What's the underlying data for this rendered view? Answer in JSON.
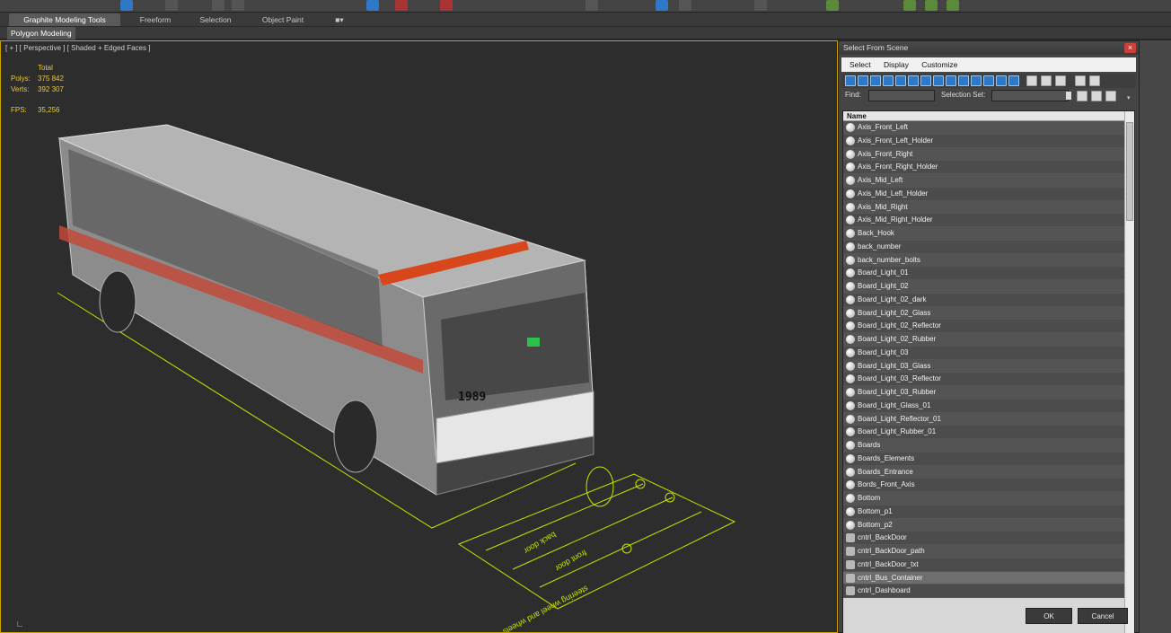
{
  "ribbon": {
    "tabs": [
      "Graphite Modeling Tools",
      "Freeform",
      "Selection",
      "Object Paint"
    ],
    "subtab": "Polygon Modeling"
  },
  "viewport": {
    "label": "[ + ] [ Perspective ] [ Shaded + Edged Faces ]",
    "stats_header": "Total",
    "polys_label": "Polys:",
    "polys_value": "375 842",
    "verts_label": "Verts:",
    "verts_value": "392 307",
    "fps_label": "FPS:",
    "fps_value": "35,256",
    "bus_number": "1989",
    "rig_labels": [
      "back door",
      "front door",
      "steering wheel and wheels"
    ]
  },
  "dialog": {
    "title": "Select From Scene",
    "close": "×",
    "menu": [
      "Select",
      "Display",
      "Customize"
    ],
    "find_label": "Find:",
    "find_value": "",
    "selset_label": "Selection Set:",
    "list_header": "Name",
    "items": [
      {
        "name": "Axis_Front_Left",
        "icon": "sphere"
      },
      {
        "name": "Axis_Front_Left_Holder",
        "icon": "sphere"
      },
      {
        "name": "Axis_Front_Right",
        "icon": "sphere"
      },
      {
        "name": "Axis_Front_Right_Holder",
        "icon": "sphere"
      },
      {
        "name": "Axis_Mid_Left",
        "icon": "sphere"
      },
      {
        "name": "Axis_Mid_Left_Holder",
        "icon": "sphere"
      },
      {
        "name": "Axis_Mid_Right",
        "icon": "sphere"
      },
      {
        "name": "Axis_Mid_Right_Holder",
        "icon": "sphere"
      },
      {
        "name": "Back_Hook",
        "icon": "sphere"
      },
      {
        "name": "back_number",
        "icon": "sphere"
      },
      {
        "name": "back_number_bolts",
        "icon": "sphere"
      },
      {
        "name": "Board_Light_01",
        "icon": "sphere"
      },
      {
        "name": "Board_Light_02",
        "icon": "sphere"
      },
      {
        "name": "Board_Light_02_dark",
        "icon": "sphere"
      },
      {
        "name": "Board_Light_02_Glass",
        "icon": "sphere"
      },
      {
        "name": "Board_Light_02_Reflector",
        "icon": "sphere"
      },
      {
        "name": "Board_Light_02_Rubber",
        "icon": "sphere"
      },
      {
        "name": "Board_Light_03",
        "icon": "sphere"
      },
      {
        "name": "Board_Light_03_Glass",
        "icon": "sphere"
      },
      {
        "name": "Board_Light_03_Reflector",
        "icon": "sphere"
      },
      {
        "name": "Board_Light_03_Rubber",
        "icon": "sphere"
      },
      {
        "name": "Board_Light_Glass_01",
        "icon": "sphere"
      },
      {
        "name": "Board_Light_Reflector_01",
        "icon": "sphere"
      },
      {
        "name": "Board_Light_Rubber_01",
        "icon": "sphere"
      },
      {
        "name": "Boards",
        "icon": "sphere"
      },
      {
        "name": "Boards_Elements",
        "icon": "sphere"
      },
      {
        "name": "Boards_Entrance",
        "icon": "sphere"
      },
      {
        "name": "Bords_Front_Axis",
        "icon": "sphere"
      },
      {
        "name": "Bottom",
        "icon": "sphere"
      },
      {
        "name": "Bottom_p1",
        "icon": "sphere"
      },
      {
        "name": "Bottom_p2",
        "icon": "sphere"
      },
      {
        "name": "cntrl_BackDoor",
        "icon": "control"
      },
      {
        "name": "cntrl_BackDoor_path",
        "icon": "control"
      },
      {
        "name": "cntrl_BackDoor_txt",
        "icon": "control"
      },
      {
        "name": "cntrl_Bus_Container",
        "icon": "control"
      },
      {
        "name": "cntrl_Dashboard",
        "icon": "control"
      }
    ],
    "selected_index": 34,
    "ok": "OK",
    "cancel": "Cancel"
  }
}
